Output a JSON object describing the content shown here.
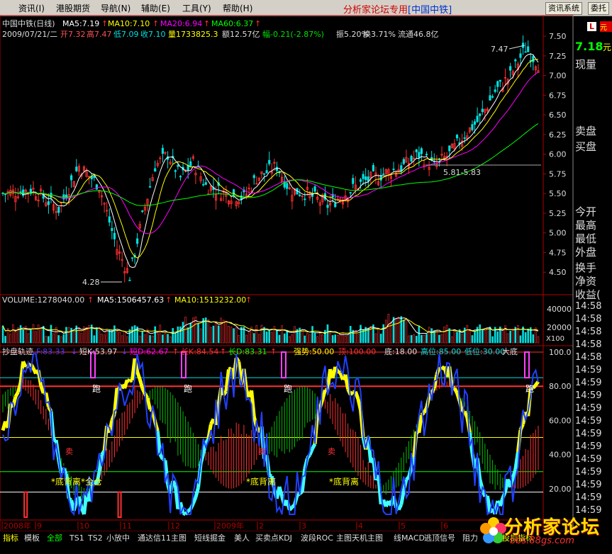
{
  "menu": {
    "items": [
      "资讯(I)",
      "港股期货",
      "导航(N)",
      "辅助(E)",
      "工具(Y)",
      "帮助(H)"
    ],
    "brand": "分析家论坛专用",
    "stock_tag": "[中国中铁]",
    "btn_news": "资讯系统",
    "btn_trade": "委托"
  },
  "header": {
    "line1_name": "中国中铁(日线)",
    "ma5": "MA5:7.19",
    "ma10": "MA10:7.10",
    "ma20": "MA20:6.94",
    "ma60": "MA60:6.37",
    "line2_date": "2009/07/21/二",
    "open": "开7.32",
    "high": "高7.47",
    "low": "低7.09",
    "close": "收7.10",
    "vol": "量1733825.3",
    "amount": "额12.57亿",
    "change": "幅-0.21(-2.87%)",
    "amplitude": "振5.20%",
    "turnover": "换3.71%",
    "float": "流通46.8亿"
  },
  "price_annotations": {
    "high_label": "7.47",
    "low_label": "4.28",
    "range_label": "5.81-5.83"
  },
  "volume_header": {
    "vol": "VOLUME:1278040.00",
    "ma5": "MA5:1506457.63",
    "ma10": "MA10:1513232.00"
  },
  "indicator_header": {
    "name": "抄盘轨迹",
    "k": "F:83.33",
    "short_k": "短K:53.97",
    "short_d": "短D:62.67",
    "long_k": "长K:84.54",
    "long_d": "长D:83.31",
    "strong": "强势:50.00",
    "top": "顶:100.00",
    "bottom": "底:18.00",
    "high_pos": "高位:85.00",
    "low_pos": "低位:30.00",
    "big_bottom": "大底"
  },
  "indicator_annotations": {
    "run1": "跑",
    "run2": "跑",
    "run3": "跑",
    "run4": "跑",
    "sell1": "卖",
    "sell2": "卖",
    "sell3": "卖",
    "bd1": "*底背离*全仓",
    "bd2": "*底背离",
    "bd3": "*底背离"
  },
  "right_panel": {
    "logo_letter": "L",
    "price": "7.18",
    "unit": "元",
    "labels": [
      "现量",
      "卖盘",
      "买盘",
      "今开",
      "最高",
      "最低",
      "外盘",
      "换手",
      "净资",
      "收益("
    ],
    "times": [
      "14:58",
      "14:58",
      "14:58",
      "14:58",
      "14:58",
      "14:59",
      "14:59",
      "14:59",
      "14:59",
      "14:59",
      "14:59",
      "14:59",
      "14:59",
      "14:59",
      "14:59",
      "14:59",
      "14:59"
    ],
    "x100": "X100"
  },
  "axis": {
    "price_ticks": [
      "7.50",
      "7.25",
      "7.00",
      "6.75",
      "6.50",
      "6.25",
      "6.00",
      "5.75",
      "5.50",
      "5.25",
      "5.00",
      "4.75",
      "4.50"
    ],
    "vol_ticks": [
      "40000",
      "20000"
    ],
    "ind_ticks": [
      "100.0",
      "80.00",
      "60.00",
      "40.00",
      "20.00"
    ],
    "date_labels": [
      "2008年",
      "9",
      "10",
      "11",
      "12",
      "2009年",
      "2",
      "3",
      "4",
      "5",
      "6",
      "7"
    ]
  },
  "bottom_tabs": [
    "指标",
    "模板",
    "全部",
    "TS1",
    "TS2",
    "小放中",
    "通达信11主图",
    "短线掘金",
    "美人",
    "买卖点KDJ",
    "波段ROC",
    "主图天机主图",
    "线MACD",
    "逃顶信号",
    "阻力"
  ],
  "bottom_right_tab": "投机指标",
  "watermark": {
    "title": "分析家论坛",
    "url": "bbs.88gs.com"
  },
  "chart_data": {
    "type": "candlestick",
    "title": "中国中铁(日线)",
    "ylim": [
      4.25,
      7.6
    ],
    "ma_series": [
      "MA5",
      "MA10",
      "MA20",
      "MA60"
    ],
    "ma_colors": [
      "#ffffff",
      "#ffff00",
      "#ff00ff",
      "#00ff00"
    ],
    "last": {
      "date": "2009/07/21",
      "open": 7.32,
      "high": 7.47,
      "low": 7.09,
      "close": 7.1
    },
    "period_high": 7.47,
    "period_low": 4.28
  }
}
